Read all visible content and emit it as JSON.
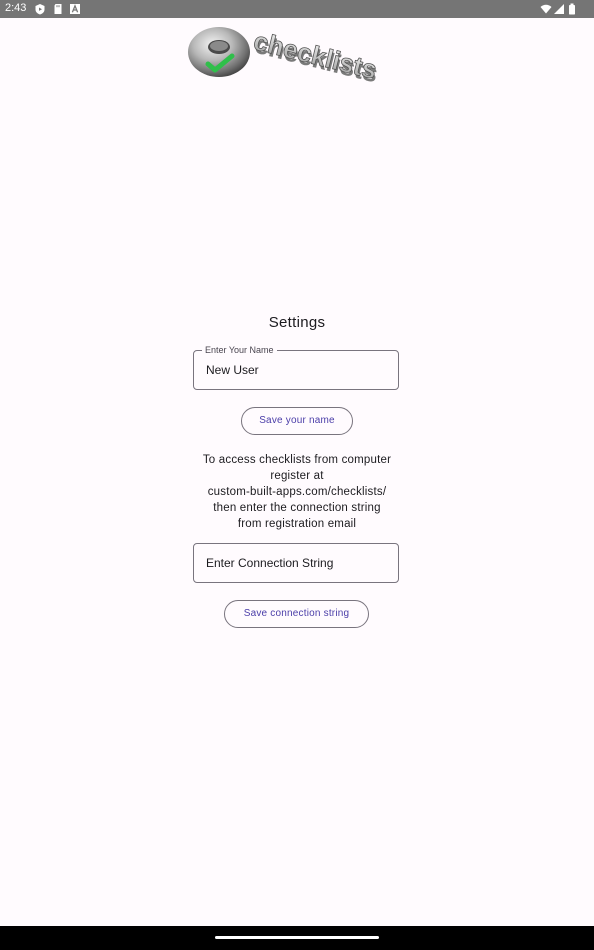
{
  "status_bar": {
    "time": "2:43",
    "left_icons": [
      "play-protect-icon",
      "sd-card-icon",
      "text-a-icon"
    ],
    "right_icons": [
      "wifi-icon",
      "signal-icon",
      "battery-icon"
    ]
  },
  "logo": {
    "text": "checklists",
    "icon": "donut-check-logo",
    "check_color": "#2fbf4a"
  },
  "page": {
    "title": "Settings"
  },
  "name_field": {
    "label": "Enter Your Name",
    "value": "New User"
  },
  "save_name_button": {
    "label": "Save your name"
  },
  "info_lines": [
    "To access checklists from computer",
    "register at",
    "custom-built-apps.com/checklists/",
    "then enter the connection string",
    "from registration email"
  ],
  "connection_field": {
    "placeholder": "Enter Connection String",
    "value": ""
  },
  "save_connection_button": {
    "label": "Save connection string"
  },
  "colors": {
    "background": "#fffbfe",
    "accent": "#4a3da8",
    "outline": "#79747e",
    "status_bar": "#757575"
  }
}
